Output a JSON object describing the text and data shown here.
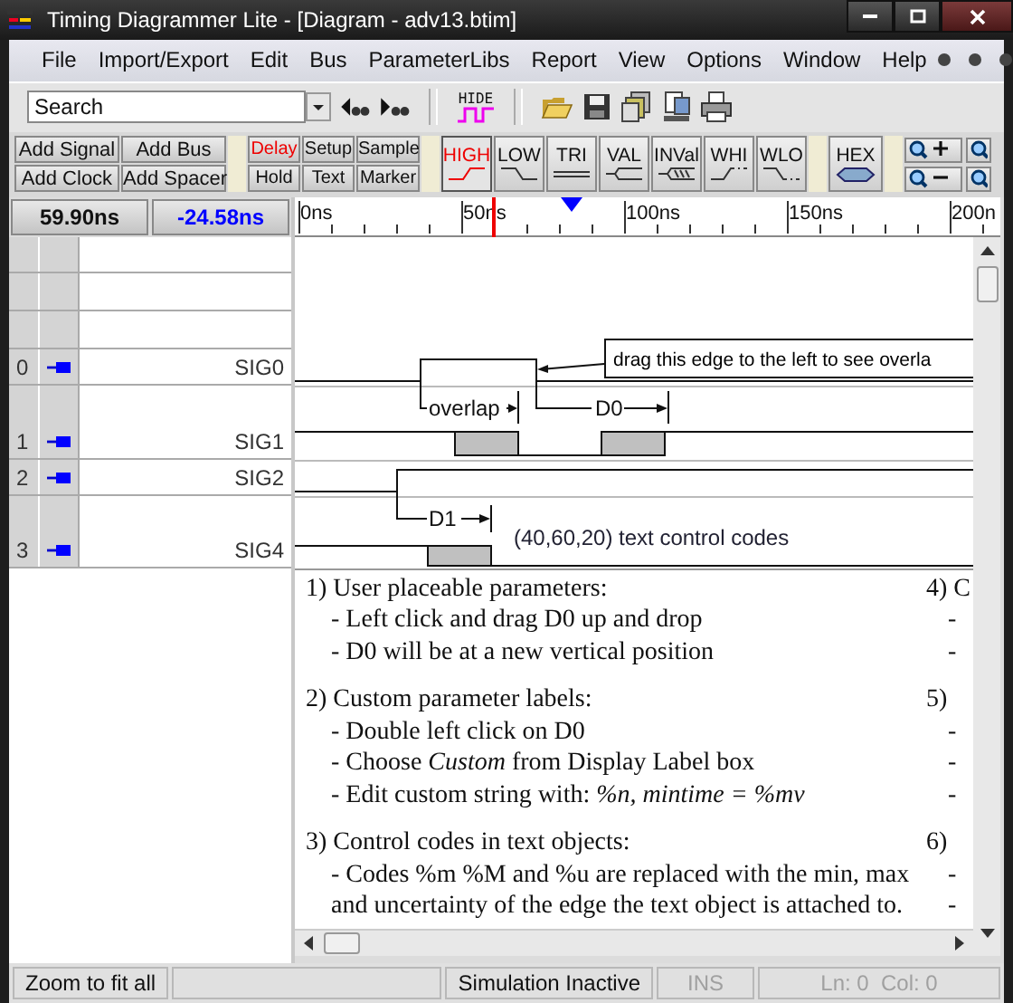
{
  "window": {
    "title": "Timing Diagrammer Lite - [Diagram - adv13.btim]"
  },
  "menu": [
    "File",
    "Import/Export",
    "Edit",
    "Bus",
    "ParameterLibs",
    "Report",
    "View",
    "Options",
    "Window",
    "Help"
  ],
  "toolbar": {
    "search": {
      "placeholder": "Search"
    },
    "hide_button": "HIDE"
  },
  "add_buttons": [
    "Add Signal",
    "Add Bus",
    "Add Clock",
    "Add Spacer"
  ],
  "parameter_tools": [
    {
      "label": "Delay",
      "selected": true
    },
    {
      "label": "Setup",
      "selected": false
    },
    {
      "label": "Sample",
      "selected": false
    },
    {
      "label": "Hold",
      "selected": false
    },
    {
      "label": "Text",
      "selected": false
    },
    {
      "label": "Marker",
      "selected": false
    }
  ],
  "edge_tools": [
    {
      "label": "HIGH",
      "kind": "rise",
      "selected": true
    },
    {
      "label": "LOW",
      "kind": "fall",
      "selected": false
    },
    {
      "label": "TRI",
      "kind": "tri",
      "selected": false
    },
    {
      "label": "VAL",
      "kind": "val",
      "selected": false
    },
    {
      "label": "INVal",
      "kind": "inval",
      "selected": false
    },
    {
      "label": "WHI",
      "kind": "whi",
      "selected": false
    },
    {
      "label": "WLO",
      "kind": "wlo",
      "selected": false
    }
  ],
  "hex_button": "HEX",
  "readouts": {
    "cursor": "59.90ns",
    "delta": "-24.58ns"
  },
  "signals": [
    {
      "number": "0",
      "name": "SIG0"
    },
    {
      "number": "1",
      "name": "SIG1"
    },
    {
      "number": "2",
      "name": "SIG2"
    },
    {
      "number": "3",
      "name": "SIG4"
    }
  ],
  "ruler": {
    "labels": [
      "0ns",
      "50ns",
      "100ns",
      "150ns",
      "200n"
    ]
  },
  "diagram": {
    "note": "drag this edge to the left to see overla",
    "overlap": "overlap",
    "d0": "D0",
    "d1": "D1",
    "text_object": "(40,60,20) text control codes"
  },
  "notes": [
    {
      "heading": "1) User placeable parameters:",
      "items": [
        "- Left click and drag D0 up and drop",
        "- D0 will be at a new vertical position"
      ]
    },
    {
      "heading": "2) Custom parameter labels:",
      "items": [
        "- Double left click on D0",
        "- Choose *Custom* from Display Label box",
        "- Edit custom string with: *%n, mintime = %mv*"
      ]
    },
    {
      "heading": "3) Control codes in text objects:",
      "items": [
        "- Codes %m %M and %u are replaced with the min, max and uncertainty of the edge the text object is attached to."
      ]
    }
  ],
  "notes_column_2": [
    {
      "heading": "4) C",
      "items": [
        "-",
        "-"
      ]
    },
    {
      "heading": "5)",
      "items": [
        "-",
        "-",
        "-"
      ]
    },
    {
      "heading": "6)",
      "items": [
        "-",
        "-"
      ]
    }
  ],
  "status_bar": {
    "hint": "Zoom to fit all",
    "simulation": "Simulation Inactive",
    "ins": {
      "text": "INS",
      "disabled": true
    },
    "position": {
      "text": "Ln: 0  Col: 0",
      "disabled": true
    }
  }
}
